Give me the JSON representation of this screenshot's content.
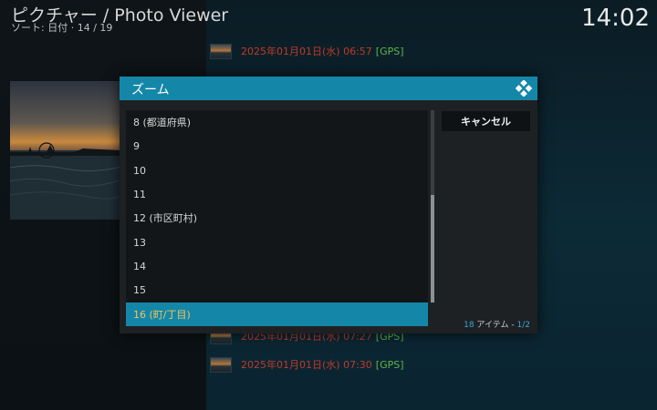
{
  "header": {
    "title": "ピクチャー / Photo Viewer",
    "sort_label": "ソート: 日付",
    "position": "14 / 19",
    "clock": "14:02"
  },
  "background_list": [
    {
      "date": "2025年01月01日(水) 06:57",
      "tag": "[GPS]"
    },
    {
      "date": "2025年01月01日(水) 07:27",
      "tag": "[GPS]"
    },
    {
      "date": "2025年01月01日(水) 07:30",
      "tag": "[GPS]"
    }
  ],
  "dialog": {
    "title": "ズーム",
    "options": [
      "8 (都道府県)",
      "9",
      "10",
      "11",
      "12 (市区町村)",
      "13",
      "14",
      "15",
      "16 (町/丁目)"
    ],
    "selected_index": 8,
    "cancel_label": "キャンセル",
    "item_count": "18",
    "item_word": "アイテム",
    "page": "1/2"
  },
  "colors": {
    "accent": "#1487a8",
    "selected_text": "#f3c260",
    "date_red": "#c0392b",
    "gps_green": "#5fb54a"
  }
}
